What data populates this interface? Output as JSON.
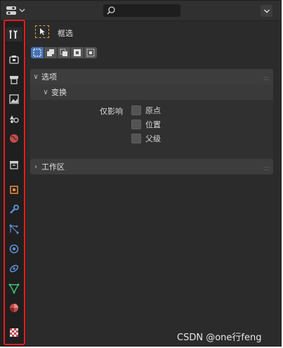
{
  "header": {
    "editor_type_icon": "properties-editor-icon",
    "search_icon": "search-icon",
    "options_icon": "chevron-down-icon"
  },
  "sidebar": {
    "tabs": [
      {
        "name": "tool-tab",
        "icon": "wrench-screwdriver-icon",
        "active": true
      },
      {
        "name": "render-tab",
        "icon": "camera-back-icon"
      },
      {
        "name": "output-tab",
        "icon": "printer-icon"
      },
      {
        "name": "view-layer-tab",
        "icon": "image-icon"
      },
      {
        "name": "scene-tab",
        "icon": "scene-icon"
      },
      {
        "name": "world-tab",
        "icon": "world-icon"
      },
      {
        "name": "collection-tab",
        "icon": "box-icon"
      },
      {
        "name": "object-tab",
        "icon": "object-icon"
      },
      {
        "name": "modifiers-tab",
        "icon": "wrench-icon"
      },
      {
        "name": "particles-tab",
        "icon": "particles-icon"
      },
      {
        "name": "physics-tab",
        "icon": "physics-icon"
      },
      {
        "name": "constraints-tab",
        "icon": "constraints-icon"
      },
      {
        "name": "data-tab",
        "icon": "mesh-data-icon"
      },
      {
        "name": "material-tab",
        "icon": "material-icon"
      },
      {
        "name": "texture-tab",
        "icon": "texture-icon"
      }
    ]
  },
  "tool": {
    "name": "框选",
    "icon": "select-box-icon"
  },
  "panels": {
    "options": {
      "title": "选项",
      "transform": {
        "title": "变换",
        "affect_only_label": "仅影响",
        "checkboxes": [
          {
            "label": "原点",
            "checked": false
          },
          {
            "label": "位置",
            "checked": false
          },
          {
            "label": "父级",
            "checked": false
          }
        ]
      }
    },
    "workspace": {
      "title": "工作区"
    }
  },
  "watermark": "CSDN @one行feng",
  "colors": {
    "highlight_border": "#e81c1c",
    "active_mode": "#4772b3",
    "tool_accent": "#e0a040"
  }
}
